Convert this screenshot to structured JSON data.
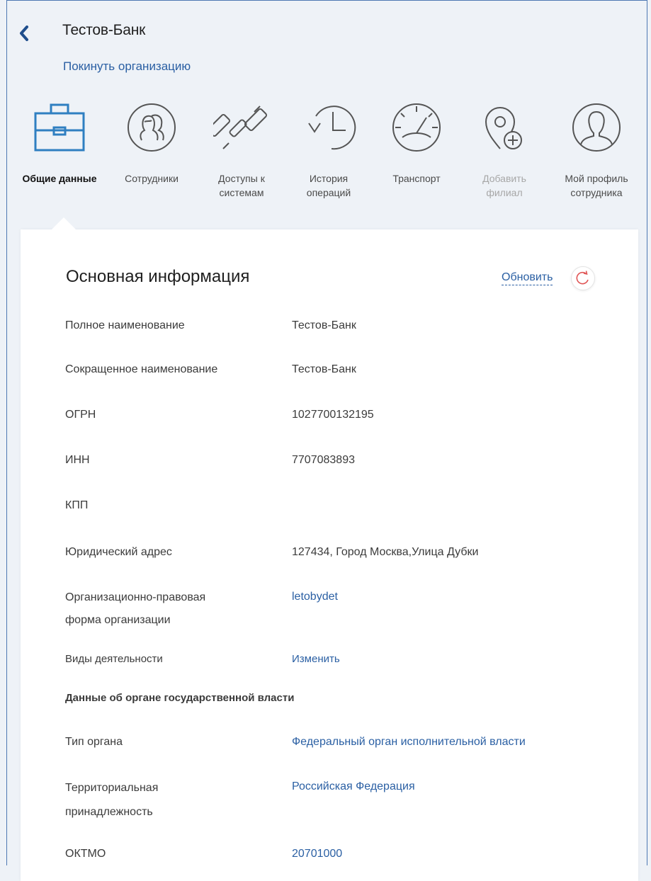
{
  "header": {
    "title": "Тестов-Банк",
    "leave_link": "Покинуть организацию"
  },
  "nav": {
    "items": [
      {
        "label": "Общие данные",
        "icon": "briefcase-icon",
        "state": "active"
      },
      {
        "label": "Сотрудники",
        "icon": "people-icon",
        "state": "normal"
      },
      {
        "label": "Доступы к\nсистемам",
        "icon": "chain-link-icon",
        "state": "normal"
      },
      {
        "label": "История\nопераций",
        "icon": "history-clock-icon",
        "state": "normal"
      },
      {
        "label": "Транспорт",
        "icon": "speedometer-icon",
        "state": "normal"
      },
      {
        "label": "Добавить\nфилиал",
        "icon": "location-add-icon",
        "state": "disabled"
      },
      {
        "label": "Мой профиль\nсотрудника",
        "icon": "user-profile-icon",
        "state": "normal"
      }
    ]
  },
  "main": {
    "section_title": "Основная информация",
    "refresh_label": "Обновить",
    "rows": [
      {
        "label": "Полное наименование",
        "value": "Тестов-Банк"
      },
      {
        "label": "Сокращенное наименование",
        "value": "Тестов-Банк"
      },
      {
        "label": "ОГРН",
        "value": "1027700132195"
      },
      {
        "label": "ИНН",
        "value": "7707083893"
      },
      {
        "label": "КПП",
        "value": ""
      },
      {
        "label": "Юридический адрес",
        "value": "127434, Город Москва,Улица Дубки"
      },
      {
        "label": "Организационно-правовая\nформа организации",
        "value": "letobydet"
      },
      {
        "label": "Виды деятельности",
        "value": "Изменить"
      }
    ],
    "gov_heading": "Данные об органе государственной власти",
    "gov_rows": [
      {
        "label": "Тип органа",
        "value": "Федеральный орган исполнительной власти"
      },
      {
        "label": "Территориальная\nпринадлежность",
        "value": "Российская Федерация"
      },
      {
        "label": "ОКТМО",
        "value": "20701000"
      }
    ]
  },
  "colors": {
    "accent": "#2a5fa3",
    "icon_active": "#2f7fc1",
    "icon_inactive": "#555555",
    "refresh_icon": "#e05555",
    "background": "#eef2f7"
  }
}
